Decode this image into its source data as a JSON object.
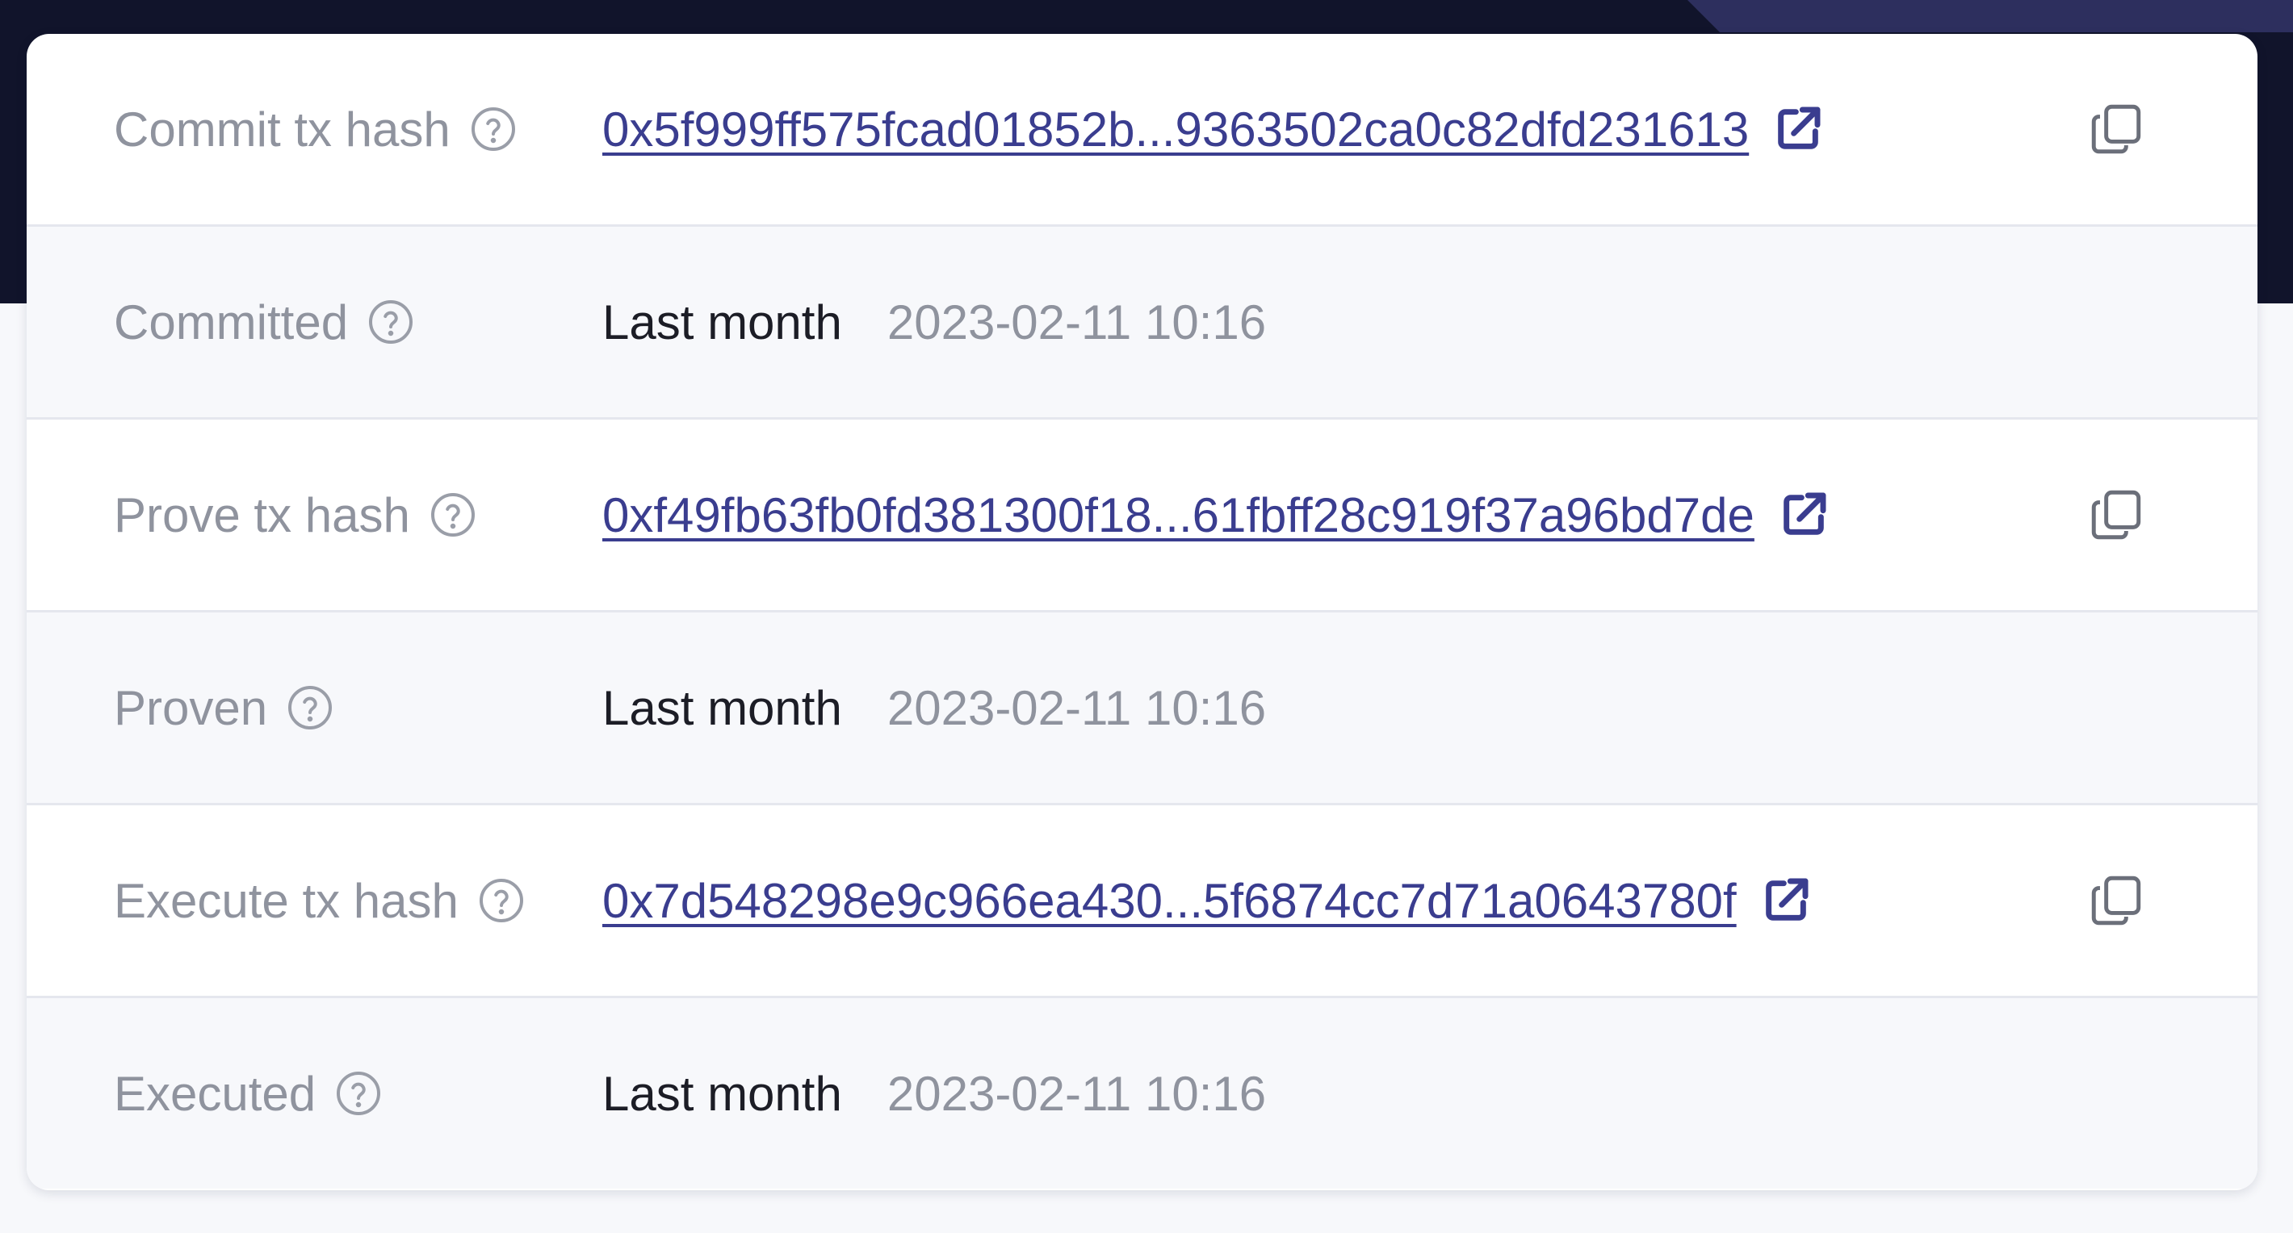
{
  "theme": {
    "header_bg": "#11142b",
    "link_color": "#3a3d8f",
    "label_color": "#8f939e",
    "text_color": "#1c1d26"
  },
  "rows": [
    {
      "label": "Commit tx hash",
      "help_icon": "question-circle-icon",
      "hash": "0x5f999ff575fcad01852b...9363502ca0c82dfd231613",
      "external_icon": "external-link-icon",
      "copy_icon": "copy-icon"
    },
    {
      "label": "Committed",
      "help_icon": "question-circle-icon",
      "relative": "Last month",
      "absolute": "2023-02-11 10:16"
    },
    {
      "label": "Prove tx hash",
      "help_icon": "question-circle-icon",
      "hash": "0xf49fb63fb0fd381300f18...61fbff28c919f37a96bd7de",
      "external_icon": "external-link-icon",
      "copy_icon": "copy-icon"
    },
    {
      "label": "Proven",
      "help_icon": "question-circle-icon",
      "relative": "Last month",
      "absolute": "2023-02-11 10:16"
    },
    {
      "label": "Execute tx hash",
      "help_icon": "question-circle-icon",
      "hash": "0x7d548298e9c966ea430...5f6874cc7d71a0643780f",
      "external_icon": "external-link-icon",
      "copy_icon": "copy-icon"
    },
    {
      "label": "Executed",
      "help_icon": "question-circle-icon",
      "relative": "Last month",
      "absolute": "2023-02-11 10:16"
    }
  ]
}
